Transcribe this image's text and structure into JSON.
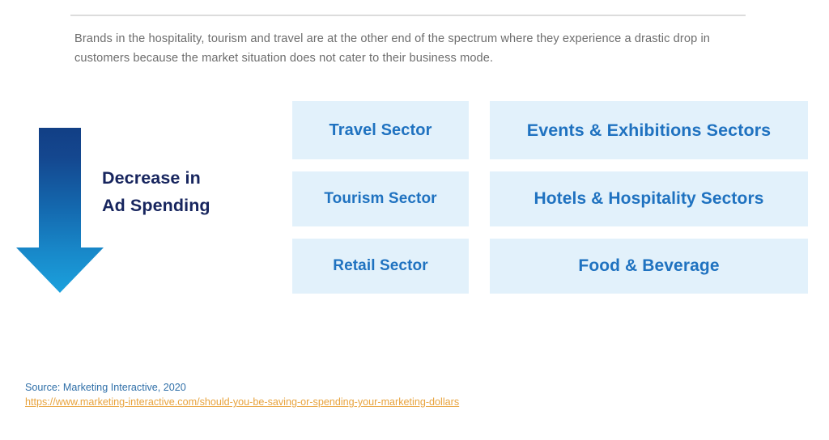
{
  "slide": {
    "intro_paragraph": "Brands in the hospitality, tourism and travel are at the other end of the spectrum where they experience a drastic drop in customers because the market situation does not cater to their business mode.",
    "divider": "horizontal-rule"
  },
  "callout": {
    "caption_line1": "Decrease in",
    "caption_line2": "Ad Spending",
    "arrow_direction": "down",
    "arrow_gradient_top": "#12448c",
    "arrow_gradient_bottom": "#1a9ad9",
    "caption_color": "#17255e"
  },
  "sectors": {
    "box_background": "#e2f1fb",
    "box_text_color": "#1f72c0",
    "left_column": [
      {
        "label": "Travel Sector"
      },
      {
        "label": "Tourism Sector"
      },
      {
        "label": "Retail Sector"
      }
    ],
    "right_column": [
      {
        "label": "Events & Exhibitions Sectors"
      },
      {
        "label": "Hotels & Hospitality Sectors"
      },
      {
        "label": "Food & Beverage"
      }
    ]
  },
  "footer": {
    "source_text": "Source: Marketing Interactive, 2020",
    "source_url": "https://www.marketing-interactive.com/should-you-be-saving-or-spending-your-marketing-dollars",
    "source_color": "#2f6fa8",
    "url_color": "#e8a33d"
  }
}
